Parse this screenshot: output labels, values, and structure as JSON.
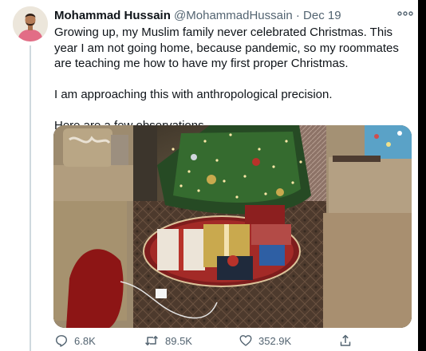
{
  "tweet": {
    "author_name": "Mohammad Hussain",
    "author_handle": "@MohammadHussain",
    "separator": "·",
    "date": "Dec 19",
    "paragraphs": [
      "Growing up, my Muslim family never celebrated Christmas. This year I am not going home, because pandemic, so my roommates are teaching me how to have my first proper Christmas.",
      "I am approaching this with anthropological precision.",
      "Here are a few observations."
    ]
  },
  "actions": {
    "replies": "6.8K",
    "retweets": "89.5K",
    "likes": "352.9K"
  },
  "icons": {
    "more": "more-icon",
    "reply": "reply-icon",
    "retweet": "retweet-icon",
    "like": "heart-icon",
    "share": "share-icon"
  },
  "colors": {
    "text": "#0f1419",
    "secondary": "#536471",
    "thread_line": "#cfd9de"
  }
}
